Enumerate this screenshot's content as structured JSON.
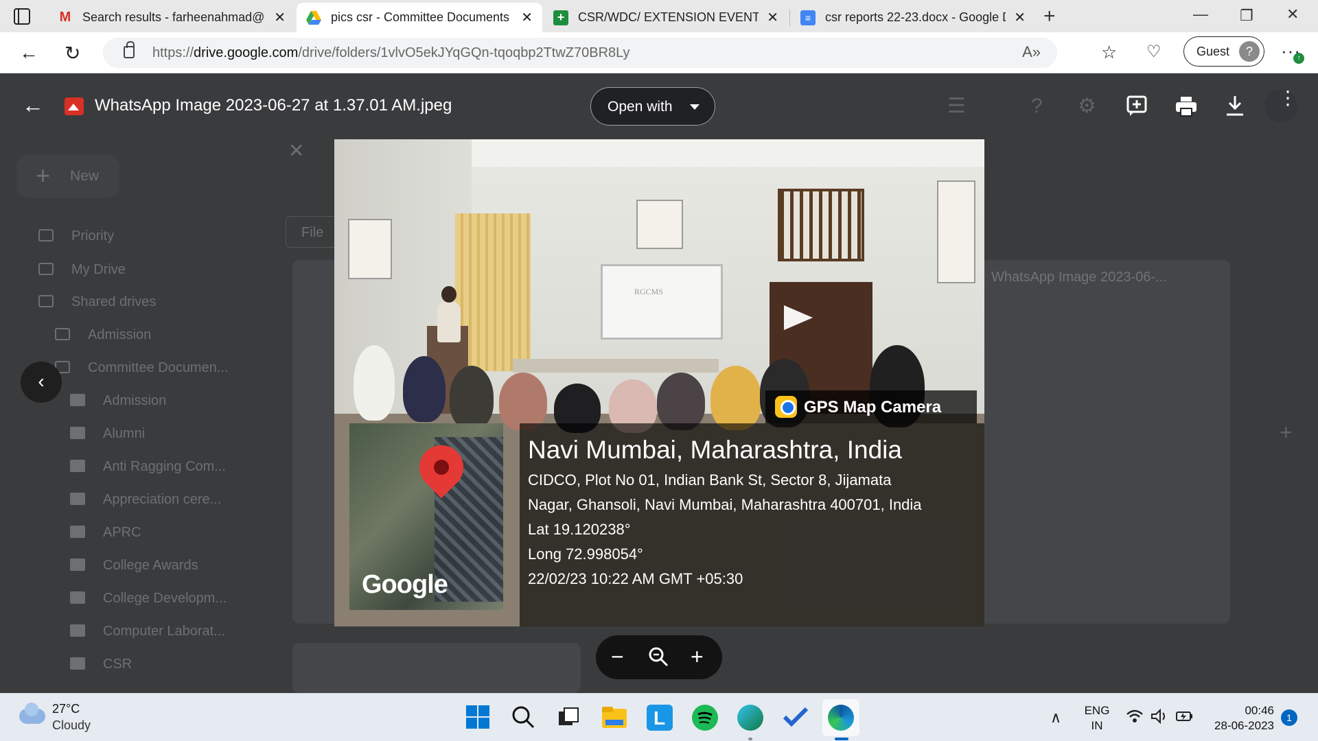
{
  "tabs": [
    {
      "title": "Search results - farheenahmad@",
      "icon": "gmail-icon",
      "active": false
    },
    {
      "title": "pics csr - Committee Documents",
      "icon": "drive-icon",
      "active": true
    },
    {
      "title": "CSR/WDC/ EXTENSION EVENTS F",
      "icon": "sheets-icon",
      "active": false
    },
    {
      "title": "csr reports 22-23.docx - Google D",
      "icon": "docs-icon",
      "active": false
    }
  ],
  "address_bar": {
    "scheme": "https://",
    "host": "drive.google.com",
    "path": "/drive/folders/1vlvO5ekJYqGQn-tqoqbp2TtwZ70BR8Ly"
  },
  "profile": {
    "label": "Guest"
  },
  "drive_bg": {
    "new_label": "New",
    "search_partial": "File",
    "sidebar": [
      "Priority",
      "My Drive",
      "Shared drives",
      "Admission",
      "Committee Documen..."
    ],
    "folders": [
      "Admission",
      "Alumni",
      "Anti Ragging Com...",
      "Appreciation cere...",
      "APRC",
      "College Awards",
      "College Developm...",
      "Computer Laborat...",
      "CSR"
    ],
    "card_title": "WhatsApp Image 2023-06-..."
  },
  "viewer": {
    "file_name": "WhatsApp Image 2023-06-27 at 1.37.01 AM.jpeg",
    "open_with_label": "Open with"
  },
  "photo": {
    "screen_text": "RGCMS",
    "gps_app": "GPS Map Camera",
    "map_word": "Google",
    "location_title": "Navi Mumbai, Maharashtra, India",
    "address_line1": "CIDCO, Plot No 01, Indian Bank St, Sector 8, Jijamata",
    "address_line2": "Nagar, Ghansoli, Navi Mumbai, Maharashtra 400701, India",
    "lat": "Lat 19.120238°",
    "long": "Long 72.998054°",
    "datetime": "22/02/23 10:22 AM GMT +05:30"
  },
  "taskbar": {
    "temperature": "27°C",
    "condition": "Cloudy",
    "lang_line1": "ENG",
    "lang_line2": "IN",
    "time": "00:46",
    "date": "28-06-2023",
    "notifications": "1"
  },
  "colors": {
    "viewer_bg": "#202124",
    "accent_red": "#d93025",
    "taskbar_accent": "#0067c0"
  }
}
